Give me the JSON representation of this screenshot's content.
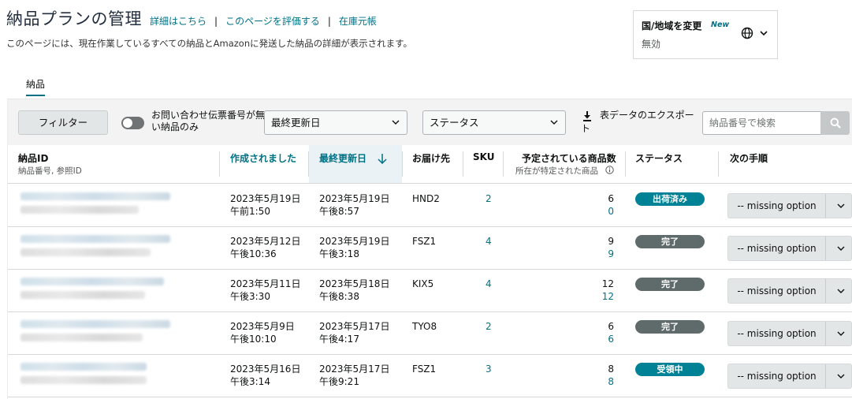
{
  "header": {
    "title": "納品プランの管理",
    "links": [
      "詳細はこちら",
      "このページを評価する",
      "在庫元帳"
    ],
    "subtitle": "このページには、現在作業しているすべての納品とAmazonに発送した納品の詳細が表示されます。"
  },
  "region": {
    "label": "国/地域を変更",
    "new_badge": "New",
    "value": "無効",
    "icon": "globe-icon"
  },
  "tabs": [
    {
      "label": "納品",
      "active": true
    }
  ],
  "toolbar": {
    "filter_label": "フィルター",
    "toggle_label": "お問い合わせ伝票番号が無い納品のみ",
    "toggle_on": false,
    "sort_select": "最終更新日",
    "status_select": "ステータス",
    "export_label": "表データのエクスポート",
    "search_placeholder": "納品番号で検索"
  },
  "columns": {
    "id": {
      "title": "納品ID",
      "sub": "納品番号, 参照ID"
    },
    "created": "作成されました",
    "updated": "最終更新日",
    "dest": "お届け先",
    "sku": "SKU",
    "expected": {
      "title": "予定されている商品数",
      "sub": "所在が特定された商品"
    },
    "status": "ステータス",
    "next": "次の手順"
  },
  "rows": [
    {
      "created_date": "2023年5月19日",
      "created_time": "午前1:50",
      "updated_date": "2023年5月19日",
      "updated_time": "午後8:57",
      "dest": "HND2",
      "sku": "2",
      "expected": "6",
      "located": "0",
      "status": "出荷済み",
      "status_color": "#008296",
      "action": "-- missing option"
    },
    {
      "created_date": "2023年5月12日",
      "created_time": "午後10:36",
      "updated_date": "2023年5月19日",
      "updated_time": "午後3:18",
      "dest": "FSZ1",
      "sku": "4",
      "expected": "9",
      "located": "9",
      "status": "完了",
      "status_color": "#5f6a6a",
      "action": "-- missing option"
    },
    {
      "created_date": "2023年5月11日",
      "created_time": "午後3:30",
      "updated_date": "2023年5月18日",
      "updated_time": "午後8:38",
      "dest": "KIX5",
      "sku": "4",
      "expected": "12",
      "located": "12",
      "status": "完了",
      "status_color": "#5f6a6a",
      "action": "-- missing option"
    },
    {
      "created_date": "2023年5月9日",
      "created_time": "午後10:10",
      "updated_date": "2023年5月17日",
      "updated_time": "午後4:17",
      "dest": "TYO8",
      "sku": "2",
      "expected": "6",
      "located": "6",
      "status": "完了",
      "status_color": "#5f6a6a",
      "action": "-- missing option"
    },
    {
      "created_date": "2023年5月16日",
      "created_time": "午後3:14",
      "updated_date": "2023年5月17日",
      "updated_time": "午後9:21",
      "dest": "FSZ1",
      "sku": "3",
      "expected": "8",
      "located": "8",
      "status": "受領中",
      "status_color": "#008296",
      "action": "-- missing option"
    }
  ]
}
